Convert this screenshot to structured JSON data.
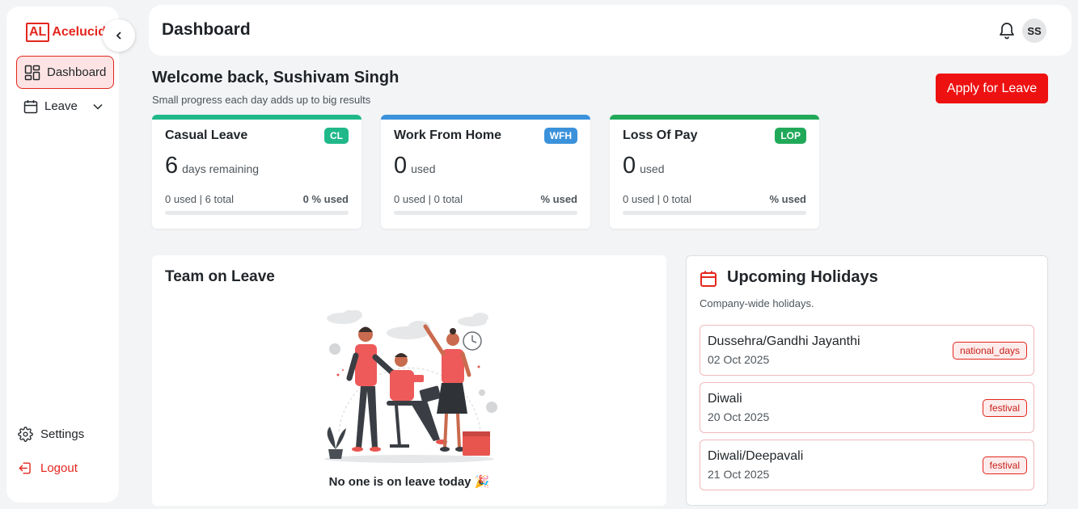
{
  "brand": {
    "mark": "AL",
    "name": "Acelucid"
  },
  "sidebar": {
    "items": [
      {
        "label": "Dashboard",
        "icon": "dashboard-icon"
      },
      {
        "label": "Leave",
        "icon": "calendar-icon"
      }
    ],
    "settings_label": "Settings",
    "logout_label": "Logout"
  },
  "header": {
    "title": "Dashboard",
    "avatar_initials": "SS"
  },
  "welcome": {
    "title": "Welcome back, Sushivam Singh",
    "subtitle": "Small progress each day adds up to big results",
    "apply_label": "Apply for Leave"
  },
  "leave_cards": [
    {
      "title": "Casual Leave",
      "badge": "CL",
      "value": "6",
      "value_label": "days remaining",
      "usage": "0 used | 6 total",
      "pct": "0 % used",
      "color": "#20b889",
      "fill_fraction": 0
    },
    {
      "title": "Work From Home",
      "badge": "WFH",
      "value": "0",
      "value_label": "used",
      "usage": "0 used | 0 total",
      "pct": "% used",
      "color": "#3b92db",
      "fill_fraction": 0
    },
    {
      "title": "Loss Of Pay",
      "badge": "LOP",
      "value": "0",
      "value_label": "used",
      "usage": "0 used | 0 total",
      "pct": "% used",
      "color": "#21a95a",
      "fill_fraction": 0
    }
  ],
  "team": {
    "title": "Team on Leave",
    "empty_message": "No one is on leave today 🎉"
  },
  "holidays": {
    "title": "Upcoming Holidays",
    "subtitle": "Company-wide holidays.",
    "items": [
      {
        "name": "Dussehra/Gandhi Jayanthi",
        "date": "02 Oct 2025",
        "tag": "national_days"
      },
      {
        "name": "Diwali",
        "date": "20 Oct 2025",
        "tag": "festival"
      },
      {
        "name": "Diwali/Deepavali",
        "date": "21 Oct 2025",
        "tag": "festival"
      }
    ]
  },
  "colors": {
    "accent": "#e3261d",
    "apply_button": "#ee1111"
  }
}
